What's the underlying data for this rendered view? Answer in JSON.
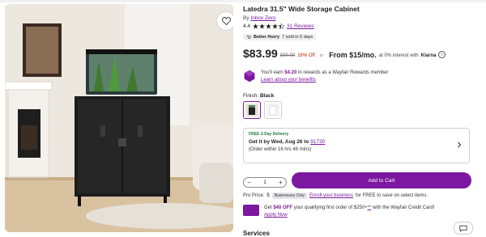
{
  "product": {
    "title": "Latedra 31.5\" Wide Storage Cabinet",
    "by_label": "By",
    "brand": "Inbox Zero",
    "rating": "4.4",
    "stars_filled": 4.4,
    "reviews": "31 Reviews",
    "hurry_label": "Better Hurry",
    "hurry_text": "7 sold in 5 days"
  },
  "pricing": {
    "price": "$83.99",
    "was_price": "$99.99",
    "discount": "16% Off",
    "or_label": "or",
    "financing": "From $15/mo.",
    "interest": "at 0% interest with",
    "klarna": "Klarna"
  },
  "rewards": {
    "text_before": "You'll earn",
    "amount": "$4.20",
    "text_after": "in rewards as a Wayfair Rewards member",
    "link": "Learn about your benefits"
  },
  "finish": {
    "label": "Finish:",
    "value": "Black"
  },
  "delivery": {
    "badge": "FREE 2-Day Delivery",
    "date_text": "Get it by Wed, Aug 26 to",
    "zip": "91730",
    "order_within": "(Order within 16 hrs 46 mins)"
  },
  "cart": {
    "qty_minus": "−",
    "qty_value": "1",
    "qty_plus": "+",
    "add_to_cart": "Add to Cart"
  },
  "pro": {
    "label": "Pro Price:",
    "currency": "$",
    "badge": "Businesses Only",
    "link": "Enroll your business",
    "after": "for FREE to save on select items."
  },
  "credit": {
    "get": "Get",
    "amount": "$40 OFF",
    "middle": "your qualifying first order of $250+",
    "footnote": "**",
    "after": "with the Wayfair Credit Card!",
    "apply": "Apply Now"
  },
  "services_title": "Services",
  "colors": {
    "brand_purple": "#7b189f",
    "star": "#1f1f1f",
    "delivery_green": "#1f7a3a"
  },
  "icons": [
    "heart-icon",
    "star-icon",
    "info-icon",
    "rewards-icon",
    "chevron-right-icon",
    "chat-icon",
    "credit-card-icon"
  ]
}
